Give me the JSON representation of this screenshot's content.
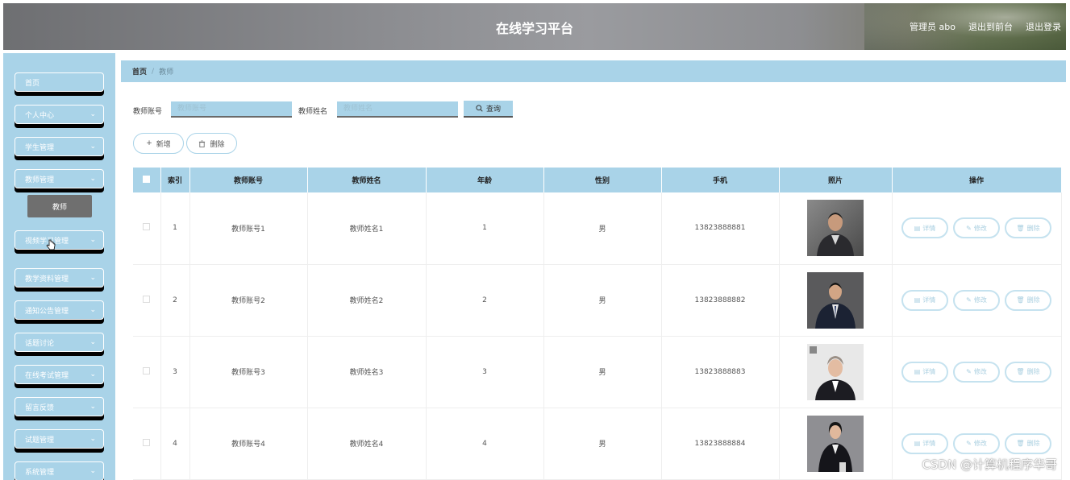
{
  "header": {
    "title": "在线学习平台",
    "user": "管理员 abo",
    "to_front": "退出到前台",
    "logout": "退出登录"
  },
  "sidebar": {
    "items": [
      {
        "label": "首页",
        "has_arrow": false
      },
      {
        "label": "个人中心",
        "has_arrow": true
      },
      {
        "label": "学生管理",
        "has_arrow": true
      },
      {
        "label": "教师管理",
        "has_arrow": true
      },
      {
        "label": "视频学习管理",
        "has_arrow": true
      },
      {
        "label": "教学资料管理",
        "has_arrow": true
      },
      {
        "label": "通知公告管理",
        "has_arrow": true
      },
      {
        "label": "话题讨论",
        "has_arrow": true
      },
      {
        "label": "在线考试管理",
        "has_arrow": true
      },
      {
        "label": "留言反馈",
        "has_arrow": true
      },
      {
        "label": "试题管理",
        "has_arrow": true
      },
      {
        "label": "系统管理",
        "has_arrow": true
      }
    ],
    "submenu_active": "教师"
  },
  "breadcrumb": {
    "home": "首页",
    "current": "教师"
  },
  "search": {
    "account_label": "教师账号",
    "account_placeholder": "教师账号",
    "name_label": "教师姓名",
    "name_placeholder": "教师姓名",
    "query_label": "查询"
  },
  "actions": {
    "add_label": "新增",
    "delete_label": "删除"
  },
  "table": {
    "columns": [
      "",
      "索引",
      "教师账号",
      "教师姓名",
      "年龄",
      "性别",
      "手机",
      "照片",
      "操作"
    ],
    "rows": [
      {
        "index": "1",
        "account": "教师账号1",
        "name": "教师姓名1",
        "age": "1",
        "gender": "男",
        "phone": "13823888881"
      },
      {
        "index": "2",
        "account": "教师账号2",
        "name": "教师姓名2",
        "age": "2",
        "gender": "男",
        "phone": "13823888882"
      },
      {
        "index": "3",
        "account": "教师账号3",
        "name": "教师姓名3",
        "age": "3",
        "gender": "男",
        "phone": "13823888883"
      },
      {
        "index": "4",
        "account": "教师账号4",
        "name": "教师姓名4",
        "age": "4",
        "gender": "男",
        "phone": "13823888884"
      }
    ],
    "op_detail": "详情",
    "op_edit": "修改",
    "op_delete": "删除"
  },
  "watermark": "CSDN @计算机程序华哥",
  "colors": {
    "accent": "#a9d3e8",
    "header_gray": "#8b8c90",
    "submenu_bg": "#6f6f6f"
  }
}
